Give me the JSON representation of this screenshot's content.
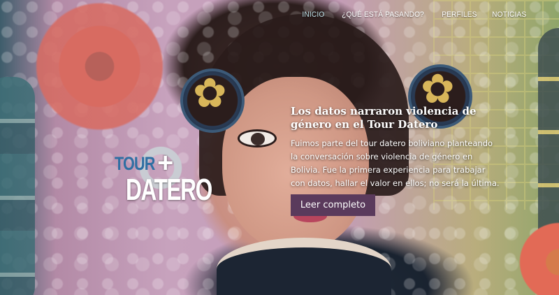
{
  "nav": {
    "items": [
      {
        "label": "INICIO",
        "active": true
      },
      {
        "label": "¿QUÉ ESTÁ PASANDO?",
        "active": false
      },
      {
        "label": "PERFILES",
        "active": false
      },
      {
        "label": "NOTICIAS",
        "active": false
      }
    ]
  },
  "logo": {
    "tour": "TOUR",
    "plus": "+",
    "datero": "DATERO"
  },
  "hero": {
    "title": "Los datos narraron violencia de género en el Tour Datero",
    "body": "Fuimos parte del tour datero boliviano planteando la conversación sobre violencia de género en Bolivia. Fue la primera experiencia para trabajar con datos, hallar el valor en ellos; no será la última.",
    "button_label": "Leer completo"
  },
  "colors": {
    "nav_active": "#bfe3ea",
    "button_bg": "#5a3a5c",
    "logo_tour": "#2f6fa3"
  }
}
